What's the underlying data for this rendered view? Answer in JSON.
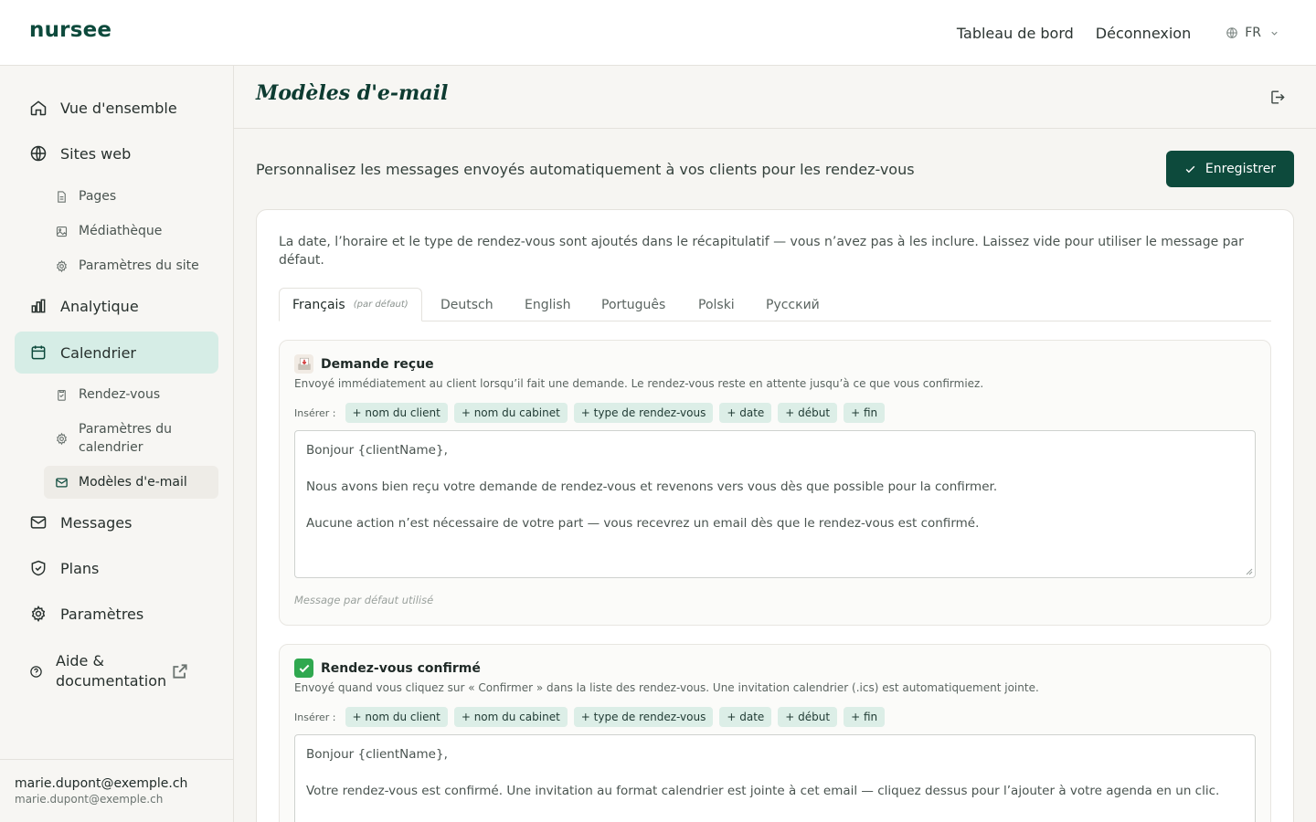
{
  "brand": "nursee",
  "topnav": {
    "dashboard": "Tableau de bord",
    "logout": "Déconnexion",
    "lang": "FR"
  },
  "sidebar": {
    "overview": "Vue d'ensemble",
    "websites": "Sites web",
    "pages": "Pages",
    "media": "Médiathèque",
    "site_settings": "Paramètres du site",
    "analytics": "Analytique",
    "calendar": "Calendrier",
    "appointments": "Rendez-vous",
    "calendar_settings": "Paramètres du calendrier",
    "email_templates": "Modèles d'e-mail",
    "messages": "Messages",
    "plans": "Plans",
    "settings": "Paramètres",
    "help": "Aide & documentation",
    "user_name": "marie.dupont@exemple.ch",
    "user_email": "marie.dupont@exemple.ch"
  },
  "page": {
    "title": "Modèles d'e-mail",
    "subtitle": "Personnalisez les messages envoyés automatiquement à vos clients pour les rendez-vous",
    "save": "Enregistrer",
    "intro": "La date, l’horaire et le type de rendez-vous sont ajoutés dans le récapitulatif — vous n’avez pas à les inclure. Laissez vide pour utiliser le message par défaut."
  },
  "tabs": {
    "fr": "Français",
    "fr_default": "(par défaut)",
    "de": "Deutsch",
    "en": "English",
    "pt": "Português",
    "pl": "Polski",
    "ru": "Русский"
  },
  "insert_label": "Insérer :",
  "chips": {
    "client": "+ nom du client",
    "cabinet": "+ nom du cabinet",
    "type": "+ type de rendez-vous",
    "date": "+ date",
    "start": "+ début",
    "end": "+ fin"
  },
  "templates": {
    "received": {
      "title": "Demande reçue",
      "desc": "Envoyé immédiatement au client lorsqu’il fait une demande. Le rendez-vous reste en attente jusqu’à ce que vous confirmiez.",
      "line1": "Bonjour {clientName},",
      "line2": "Nous avons bien reçu votre demande de rendez-vous et revenons vers vous dès que possible pour la confirmer.",
      "line3": "Aucune action n’est nécessaire de votre part — vous recevrez un email dès que le rendez-vous est confirmé.",
      "footer": "Message par défaut utilisé"
    },
    "confirmed": {
      "title": "Rendez-vous confirmé",
      "desc": "Envoyé quand vous cliquez sur « Confirmer » dans la liste des rendez-vous. Une invitation calendrier (.ics) est automatiquement jointe.",
      "line1": "Bonjour {clientName},",
      "line2": "Votre rendez-vous est confirmé. Une invitation au format calendrier est jointe à cet email — cliquez dessus pour l’ajouter à votre agenda en un clic."
    }
  },
  "colors": {
    "brand": "#0d4a3c",
    "active_nav": "#d6ede6",
    "chip": "#dceee7"
  }
}
